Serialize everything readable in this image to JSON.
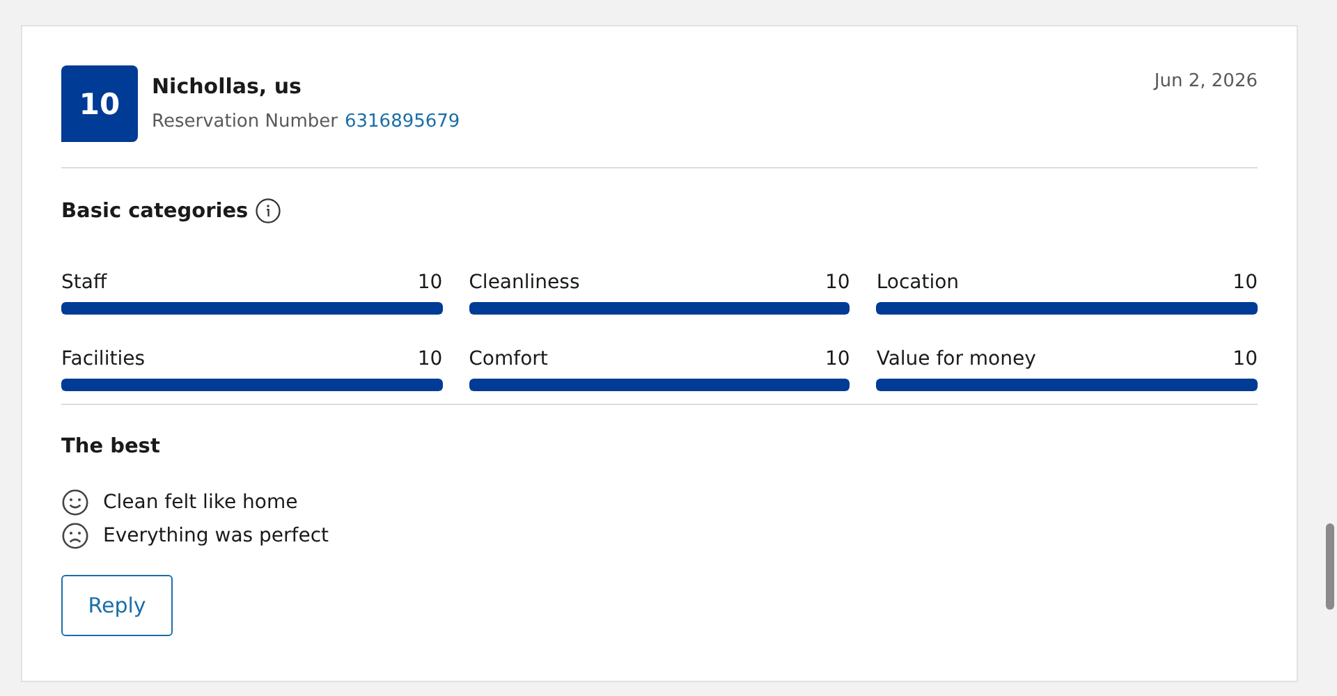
{
  "review": {
    "score": "10",
    "guest": "Nichollas, us",
    "reservation_label": "Reservation Number",
    "reservation_number": "6316895679",
    "date": "Jun 2, 2026"
  },
  "categories_title": "Basic categories",
  "categories": [
    {
      "name": "Staff",
      "score": "10",
      "level": 1
    },
    {
      "name": "Cleanliness",
      "score": "10",
      "level": 1
    },
    {
      "name": "Location",
      "score": "10",
      "level": 1
    },
    {
      "name": "Facilities",
      "score": "10",
      "level": 1
    },
    {
      "name": "Comfort",
      "score": "10",
      "level": 1
    },
    {
      "name": "Value for money",
      "score": "10",
      "level": 1
    }
  ],
  "highlights_title": "The best",
  "highlights": [
    {
      "kind": "positive",
      "text": "Clean felt like home"
    },
    {
      "kind": "negative",
      "text": "Everything was perfect"
    }
  ],
  "reply_button": "Reply"
}
